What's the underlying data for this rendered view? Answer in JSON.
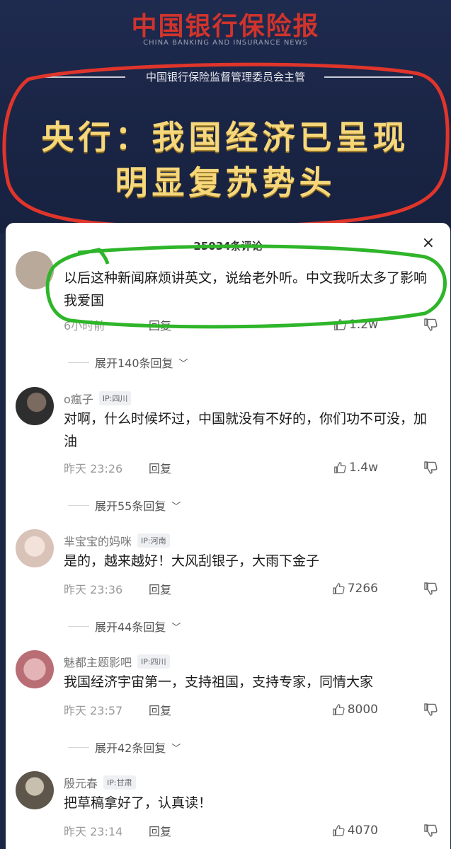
{
  "banner": {
    "paper_title": "中国银行保险报",
    "paper_subtitle": "CHINA BANKING AND INSURANCE NEWS",
    "supervisor": "中国银行保险监督管理委员会主管",
    "headline_line1": "央行：我国经济已呈现",
    "headline_line2": "明显复苏势头"
  },
  "sheet": {
    "title": "25034条评论",
    "close_glyph": "×"
  },
  "comments": [
    {
      "username": "",
      "ip": "",
      "text": "以后这种新闻麻烦讲英文，说给老外听。中文我听太多了影响我爱国",
      "time": "6小时前",
      "reply": "回复",
      "likes": "1.2w",
      "expand": "展开140条回复",
      "avatar_color": "#b9a99a"
    },
    {
      "username": "o瘋子",
      "ip": "IP:四川",
      "text": "对啊，什么时候坏过，中国就没有不好的，你们功不可没，加油",
      "time": "昨天 23:26",
      "reply": "回复",
      "likes": "1.4w",
      "expand": "展开55条回复",
      "avatar_color": "#4a4a4a"
    },
    {
      "username": "芈宝宝的妈咪",
      "ip": "IP:河南",
      "text": "是的，越来越好！大风刮银子，大雨下金子",
      "time": "昨天 23:36",
      "reply": "回复",
      "likes": "7266",
      "expand": "展开44条回复",
      "avatar_color": "#e9d6cf"
    },
    {
      "username": "魅都主题影吧",
      "ip": "IP:四川",
      "text": "我国经济宇宙第一，支持祖国，支持专家，同情大家",
      "time": "昨天 23:57",
      "reply": "回复",
      "likes": "8000",
      "expand": "展开42条回复",
      "avatar_color": "#c98a8f"
    },
    {
      "username": "殷元春",
      "ip": "IP:甘肃",
      "text": "把草稿拿好了，认真读！",
      "time": "昨天 23:14",
      "reply": "回复",
      "likes": "4070",
      "expand": "",
      "avatar_color": "#8a7e70"
    }
  ],
  "colors": {
    "banner_bg": "#1c2746",
    "paper_title_red": "#d0342c",
    "headline_gold": "#f6d77a",
    "annotation_red": "#e0352b",
    "annotation_green": "#2fb52a"
  }
}
